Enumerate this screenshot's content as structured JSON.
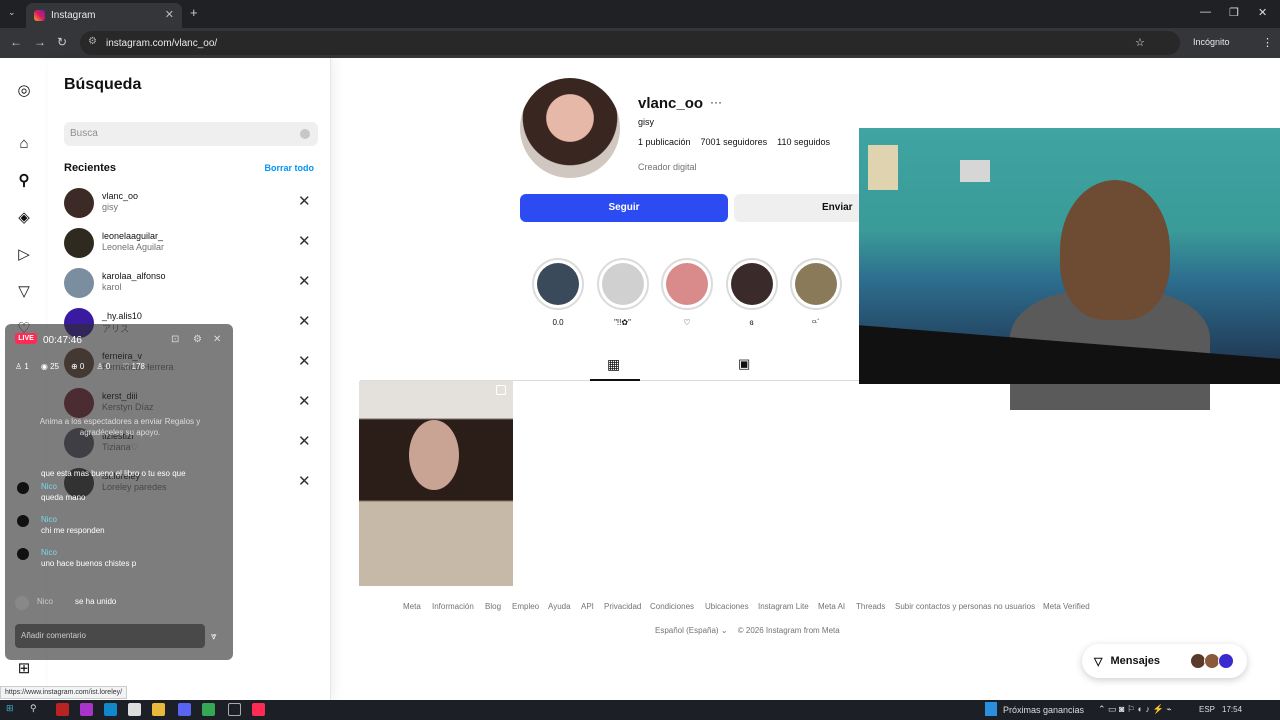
{
  "browser": {
    "tab_title": "Instagram",
    "tab_close": "✕",
    "new_tab": "+",
    "url": "instagram.com/vlanc_oo/",
    "incognito": "Incógnito"
  },
  "search_panel": {
    "title": "Búsqueda",
    "placeholder": "Busca",
    "recents_label": "Recientes",
    "clear_all": "Borrar todo",
    "items": [
      {
        "username": "vlanc_oo",
        "name": "gisy",
        "color": "#3b2a26"
      },
      {
        "username": "leonelaaguilar_",
        "name": "Leonela Aguilar",
        "color": "#2e2a1f"
      },
      {
        "username": "karolaa_alfonso",
        "name": "karol",
        "color": "#7a8ea0"
      },
      {
        "username": "_hy.alis10",
        "name": "アリス",
        "color": "#3a1aa0"
      },
      {
        "username": "ferneira_v",
        "name": "Fernanda Herrera",
        "color": "#6b4a3a"
      },
      {
        "username": "kerst_diii",
        "name": "Kerstyn Díaz",
        "color": "#7a2a3a"
      },
      {
        "username": "tiziestizi",
        "name": "Tiziana♡",
        "color": "#5a5a6a"
      },
      {
        "username": "ist.loreley",
        "name": "Loreley paredes",
        "color": "#3a3a3a"
      }
    ]
  },
  "profile": {
    "username": "vlanc_oo",
    "more": "···",
    "name": "gisy",
    "posts": "1 publicación",
    "followers": "7001 seguidores",
    "following": "110 seguidos",
    "category": "Creador digital",
    "follow_button": "Seguir",
    "message_button": "Enviar mensaje",
    "highlights": [
      {
        "label": "0.0",
        "color": "#3a4a5a"
      },
      {
        "label": "\"!!✿\"",
        "color": "#d0d0d0"
      },
      {
        "label": "♡",
        "color": "#d98a8a"
      },
      {
        "label": "ɞ",
        "color": "#3a2a2a"
      },
      {
        "label": "ᶜᶫ´",
        "color": "#8a7a5a"
      }
    ]
  },
  "footer": {
    "links": [
      "Meta",
      "Información",
      "Blog",
      "Empleo",
      "Ayuda",
      "API",
      "Privacidad",
      "Condiciones",
      "Ubicaciones",
      "Instagram Lite",
      "Meta AI",
      "Threads",
      "Subir contactos y personas no usuarios",
      "Meta Verified"
    ],
    "language": "Español (España)",
    "copyright": "© 2026 Instagram from Meta"
  },
  "live_overlay": {
    "badge": "LIVE",
    "time": "00:47:46",
    "stats": [
      "1",
      "25",
      "0",
      "0",
      "178"
    ],
    "hint": "Anima a los espectadores a enviar Regalos y agradéceles su apoyo.",
    "comments": [
      {
        "name": "",
        "text": "que esta mas bueno el libro o tu eso que"
      },
      {
        "name": "Nico",
        "text": "queda mano"
      },
      {
        "name": "Nico",
        "text": "chi me responden"
      },
      {
        "name": "Nico",
        "text": "uno hace buenos chistes p"
      }
    ],
    "join_name": "Nico",
    "join_text": "se ha unido",
    "input_placeholder": "Añadir comentario"
  },
  "messages_button": "Mensajes",
  "status_url": "https://www.instagram.com/ist.loreley/",
  "taskbar": {
    "earnings": "Próximas ganancias",
    "lang": "ESP",
    "time": "17:54"
  }
}
